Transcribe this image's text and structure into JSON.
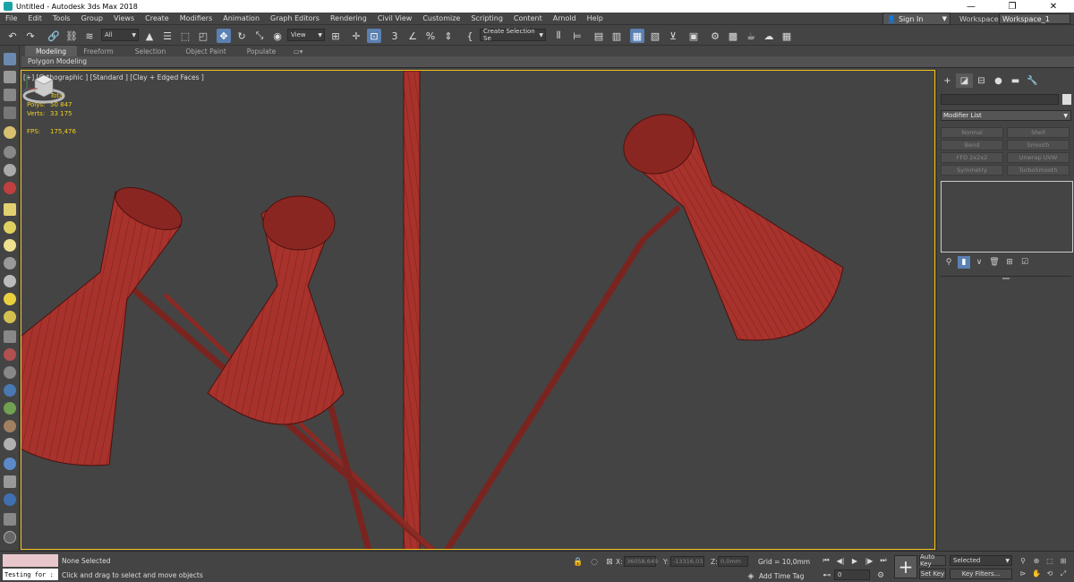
{
  "window": {
    "title": "Untitled - Autodesk 3ds Max 2018",
    "minimize": "—",
    "maximize": "❐",
    "close": "✕"
  },
  "menu": {
    "items": [
      "File",
      "Edit",
      "Tools",
      "Group",
      "Views",
      "Create",
      "Modifiers",
      "Animation",
      "Graph Editors",
      "Rendering",
      "Civil View",
      "Customize",
      "Scripting",
      "Content",
      "Arnold",
      "Help"
    ],
    "sign_in": "Sign In",
    "workspaces_label": "Workspaces:",
    "workspace_value": "Workspace_1"
  },
  "toolbar": {
    "selection_filter": "All",
    "ref_coord": "View",
    "named_selection": "Create Selection Se"
  },
  "ribbon": {
    "tabs": [
      "Modeling",
      "Freeform",
      "Selection",
      "Object Paint",
      "Populate"
    ],
    "active_tab": "Modeling",
    "panel_label": "Polygon Modeling"
  },
  "viewport": {
    "label": "[+] [Orthographic ] [Standard ] [Clay + Edged Faces ]",
    "stats": {
      "header": "Total",
      "polys_label": "Polys:",
      "polys_value": "50 847",
      "verts_label": "Verts:",
      "verts_value": "33 175",
      "fps_label": "FPS:",
      "fps_value": "175,476"
    },
    "mesh_color": "#a8322c",
    "active_border": "#f0c21b"
  },
  "command_panel": {
    "modifier_list": "Modifier List",
    "modifier_buttons": [
      "Normal",
      "Shell",
      "Bend",
      "Smooth",
      "FFD 2x2x2",
      "Unwrap UVW",
      "Symmetry",
      "TurboSmooth"
    ]
  },
  "status": {
    "maxscript_text": "Testing for :",
    "selection": "None Selected",
    "prompt": "Click and drag to select and move objects",
    "x_label": "X:",
    "x_value": "36058,649",
    "y_label": "Y:",
    "y_value": "-13316,03",
    "z_label": "Z:",
    "z_value": "0,0mm",
    "grid": "Grid = 10,0mm",
    "add_time_tag": "Add Time Tag",
    "frame_value": "0",
    "auto_key": "Auto Key",
    "set_key": "Set Key",
    "selected": "Selected",
    "key_filters": "Key Filters..."
  }
}
